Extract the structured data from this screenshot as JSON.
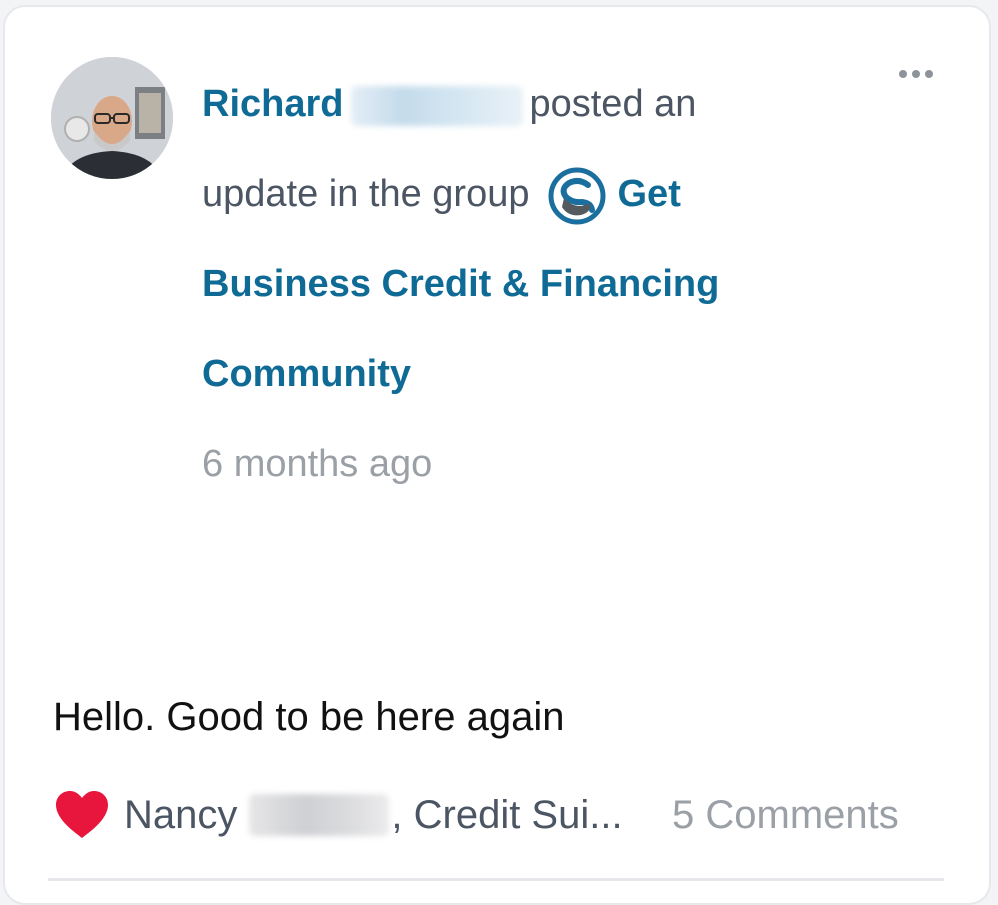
{
  "post": {
    "author_first": "Richard",
    "action_text": "posted an",
    "action_text2": "update in the group",
    "group_name": "Get Business Credit & Financing Community",
    "timestamp": "6 months ago",
    "body": "Hello. Good to be here again"
  },
  "reactions": {
    "icon": "heart-icon",
    "first_name": "Nancy",
    "others": ", Credit Sui..."
  },
  "comments_label": "5 Comments",
  "colors": {
    "link": "#0f6b96",
    "heart": "#e8153c",
    "muted": "#9aa0a6"
  }
}
